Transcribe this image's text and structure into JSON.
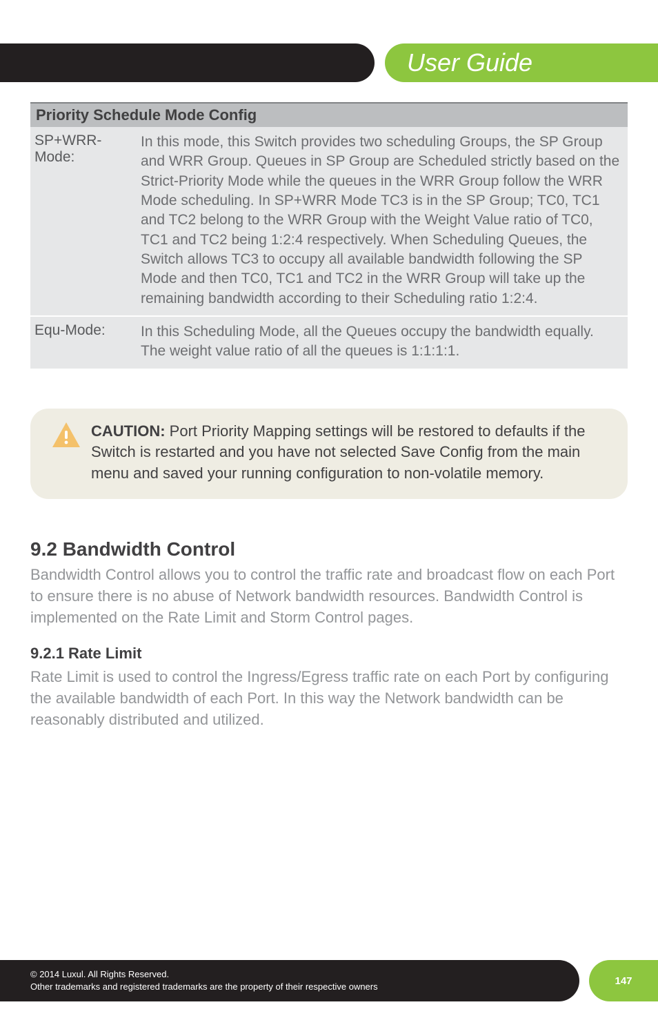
{
  "header": {
    "title": "User Guide"
  },
  "table": {
    "title": "Priority Schedule Mode Config",
    "rows": [
      {
        "label": "SP+WRR-Mode:",
        "body": "In this mode, this Switch provides two scheduling Groups, the SP Group and WRR Group. Queues in SP Group are Scheduled strictly based on the Strict-Priority Mode while the queues in the WRR Group follow the WRR Mode scheduling. In SP+WRR Mode TC3 is in the SP Group; TC0, TC1 and TC2 belong to the WRR Group with the Weight Value ratio of TC0, TC1 and TC2 being 1:2:4 respectively. When Scheduling Queues, the Switch allows TC3 to occupy all available bandwidth following the SP Mode and then TC0, TC1 and TC2 in the WRR Group will take up the remaining bandwidth according to their Scheduling ratio 1:2:4."
      },
      {
        "label": "Equ-Mode:",
        "body": "In this Scheduling Mode, all the Queues occupy the bandwidth equally. The weight value ratio of all the queues is 1:1:1:1."
      }
    ]
  },
  "caution": {
    "label": "CAUTION:",
    "body": " Port Priority Mapping settings will be restored to defaults if the Switch is restarted and you have not selected Save Config from the main menu and saved your running configuration to non-volatile memory."
  },
  "sections": {
    "bandwidth": {
      "heading": "9.2 Bandwidth Control",
      "body": "Bandwidth Control allows you to control the traffic rate and broadcast flow on each Port to ensure there is no abuse of Network bandwidth resources. Bandwidth Control is implemented on the Rate Limit and Storm Control pages."
    },
    "ratelimit": {
      "heading": "9.2.1 Rate Limit",
      "body": "Rate Limit is used to control the Ingress/Egress traffic rate on each Port by configuring the available bandwidth of each Port. In this way the Network bandwidth can be reasonably distributed and utilized."
    }
  },
  "footer": {
    "line1_prefix": "© 2014  Luxul. All Rights Reserved.",
    "line2": "Other trademarks and registered trademarks are the property of their respective owners",
    "page": "147"
  }
}
